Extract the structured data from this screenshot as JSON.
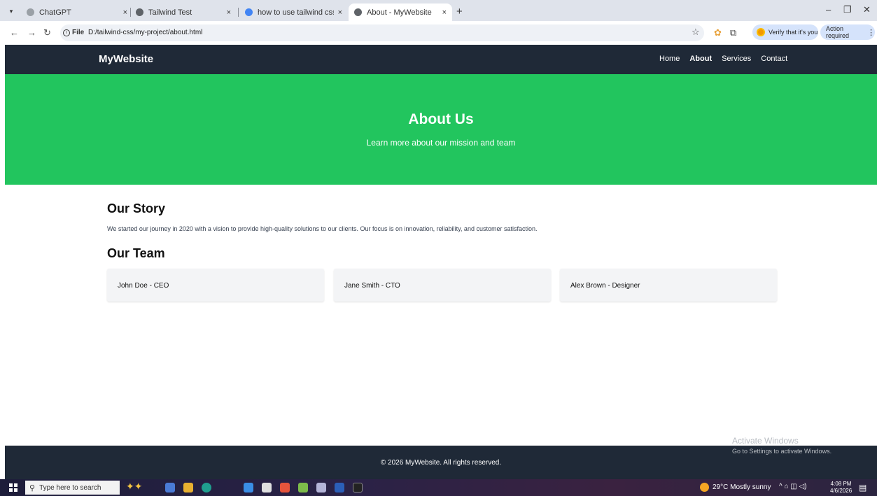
{
  "browser": {
    "tabs": [
      {
        "label": "ChatGPT",
        "favicon_color": "#9aa0a6",
        "active": false
      },
      {
        "label": "Tailwind Test",
        "favicon_color": "#5f6368",
        "active": false
      },
      {
        "label": "how to use tailwind css in wind",
        "favicon_color": "#4285f4",
        "active": false
      },
      {
        "label": "About - MyWebsite",
        "favicon_color": "#5f6368",
        "active": true
      }
    ],
    "url_scheme": "File",
    "url": "D:/tailwind-css/my-project/about.html",
    "verify_label": "Verify that it's you",
    "action_label": "Action required",
    "tab_close_glyph": "×",
    "new_tab_glyph": "+"
  },
  "site": {
    "brand": "MyWebsite",
    "nav": [
      "Home",
      "About",
      "Services",
      "Contact"
    ],
    "current_nav": "About",
    "nav_bg": "#1f2937",
    "hero": {
      "title": "About Us",
      "subtitle": "Learn more about our mission and team",
      "bg": "#22c55e"
    },
    "story": {
      "heading": "Our Story",
      "text": "We started our journey in 2020 with a vision to provide high-quality solutions to our clients. Our focus is on innovation, reliability, and customer satisfaction."
    },
    "team": {
      "heading": "Our Team",
      "members": [
        "John Doe - CEO",
        "Jane Smith - CTO",
        "Alex Brown - Designer"
      ]
    },
    "footer": "© 2026 MyWebsite. All rights reserved."
  },
  "os": {
    "watermark_title": "Activate Windows",
    "watermark_sub": "Go to Settings to activate Windows.",
    "search_placeholder": "Type here to search",
    "weather": "29°C  Mostly sunny",
    "time": "4:08 PM",
    "date": "4/6/2026"
  }
}
